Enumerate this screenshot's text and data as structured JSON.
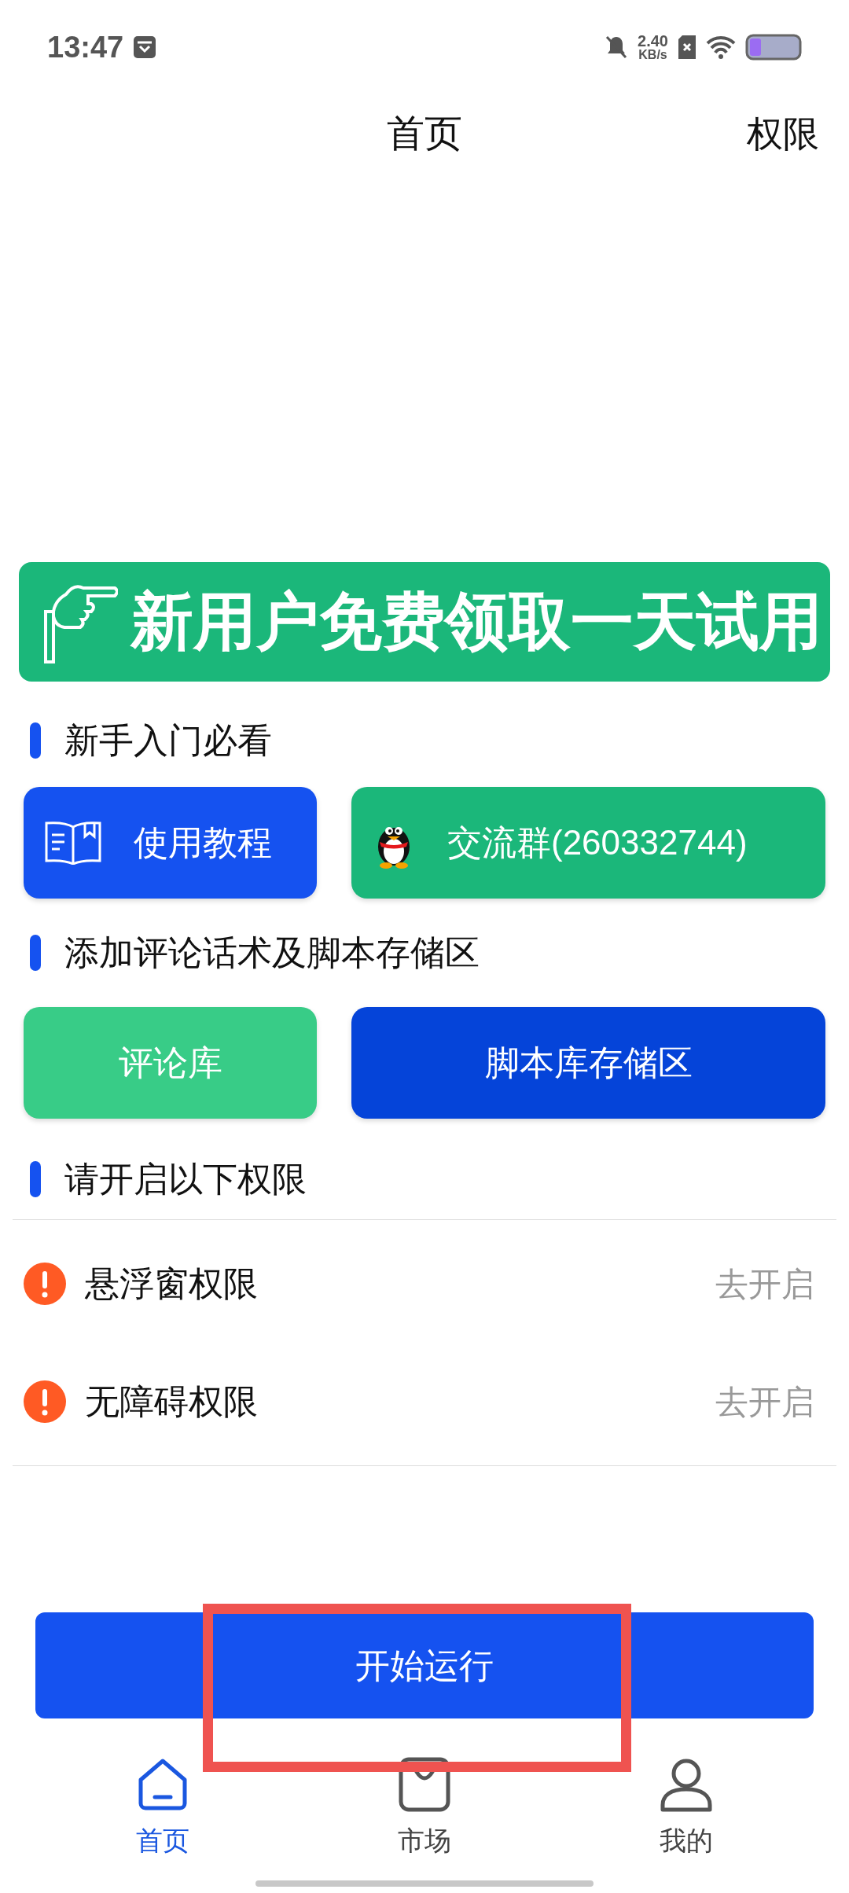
{
  "status_bar": {
    "time": "13:47",
    "speed_value": "2.40",
    "speed_unit": "KB/s"
  },
  "header": {
    "title": "首页",
    "action": "权限"
  },
  "banner": {
    "text": "新用户免费领取一天试用"
  },
  "sections": [
    {
      "title": "新手入门必看",
      "buttons": [
        {
          "label": "使用教程",
          "kind": "tutorial"
        },
        {
          "label": "交流群(260332744)",
          "kind": "group"
        }
      ]
    },
    {
      "title": "添加评论话术及脚本存储区",
      "buttons": [
        {
          "label": "评论库",
          "kind": "comments"
        },
        {
          "label": "脚本库存储区",
          "kind": "scripts"
        }
      ]
    },
    {
      "title": "请开启以下权限"
    }
  ],
  "permissions": [
    {
      "name": "悬浮窗权限",
      "action": "去开启"
    },
    {
      "name": "无障碍权限",
      "action": "去开启"
    }
  ],
  "run_button": {
    "label": "开始运行"
  },
  "bottom_nav": [
    {
      "label": "首页",
      "selected": true,
      "kind": "home"
    },
    {
      "label": "市场",
      "selected": false,
      "kind": "market"
    },
    {
      "label": "我的",
      "selected": false,
      "kind": "profile"
    }
  ]
}
